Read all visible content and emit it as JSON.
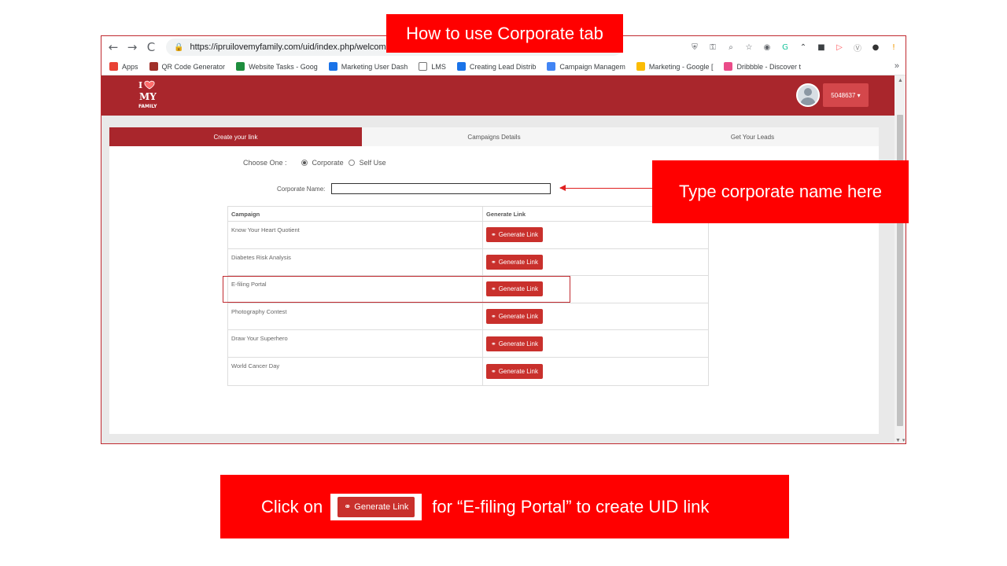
{
  "browser": {
    "url": "https://ipruilovemyfamily.com/uid/index.php/welcome/",
    "nav": {
      "back": "←",
      "forward": "→",
      "reload": "C",
      "lock": "🔒"
    },
    "extensions": [
      {
        "name": "shield-ext-icon",
        "glyph": "⛨",
        "color": "#5f6368"
      },
      {
        "name": "key-icon",
        "glyph": "⚿",
        "color": "#5f6368"
      },
      {
        "name": "zoom-icon",
        "glyph": "⌕",
        "color": "#5f6368"
      },
      {
        "name": "star-icon",
        "glyph": "☆",
        "color": "#5f6368"
      },
      {
        "name": "camera-icon",
        "glyph": "◉",
        "color": "#5f6368"
      },
      {
        "name": "grammarly-icon",
        "glyph": "G",
        "color": "#15c39a"
      },
      {
        "name": "mountain-icon",
        "glyph": "⌃",
        "color": "#3c4043"
      },
      {
        "name": "box-icon",
        "glyph": "■",
        "color": "#3c4043"
      },
      {
        "name": "cast-icon",
        "glyph": "▷",
        "color": "#ff5a5f"
      },
      {
        "name": "v-icon",
        "glyph": "Ⓥ",
        "color": "#888888"
      },
      {
        "name": "profile-icon",
        "glyph": "●",
        "color": "#333333"
      },
      {
        "name": "update-icon",
        "glyph": "!",
        "color": "#f29900"
      }
    ],
    "bookmarks": [
      {
        "label": "Apps",
        "color": "#e94235"
      },
      {
        "label": "QR Code Generator",
        "color": "#a0302a"
      },
      {
        "label": "Website Tasks - Goog",
        "color": "#1e8e3e"
      },
      {
        "label": "Marketing User Dash",
        "color": "#1a73e8"
      },
      {
        "label": "LMS",
        "color": "#ffffff"
      },
      {
        "label": "Creating Lead Distrib",
        "color": "#1a73e8"
      },
      {
        "label": "Campaign Managem",
        "color": "#4285f4"
      },
      {
        "label": "Marketing - Google [",
        "color": "#fbbc04"
      },
      {
        "label": "Dribbble - Discover t",
        "color": "#ea4c89"
      }
    ],
    "bookmarks_more": "»"
  },
  "app": {
    "logo_text": "I ♥ MY FAMILY",
    "user_id": "5048637 ▾",
    "tabs": [
      {
        "label": "Create your link",
        "active": true
      },
      {
        "label": "Campaigns Details",
        "active": false
      },
      {
        "label": "Get Your Leads",
        "active": false
      }
    ],
    "choose_label": "Choose One :",
    "option_corporate": "Corporate",
    "option_self": "Self Use",
    "corporate_label": "Corporate Name:",
    "corporate_value": "",
    "table": {
      "headers": [
        "Campaign",
        "Generate Link"
      ],
      "button_label": "Generate Link",
      "rows": [
        "Know Your Heart Quotient",
        "Diabetes Risk Analysis",
        "E-filing Portal",
        "Photography Contest",
        "Draw Your Superhero",
        "World Cancer Day"
      ]
    }
  },
  "annotations": {
    "title": "How to use Corporate tab",
    "right": "Type corporate name here",
    "bottom_part1": "Click on",
    "bottom_button": "Generate Link",
    "bottom_part2": "for “E-filing Portal” to create UID link"
  },
  "colors": {
    "annotation_red": "#ff0000",
    "header_red": "#a9262c",
    "button_red": "#c9302c"
  }
}
